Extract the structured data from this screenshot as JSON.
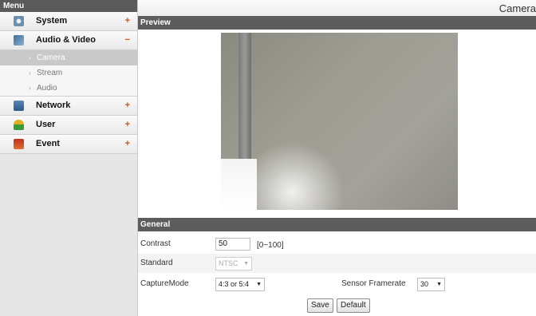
{
  "sidebar": {
    "header": "Menu",
    "items": [
      {
        "label": "System",
        "toggle": "+",
        "icon": "gear-icon"
      },
      {
        "label": "Audio & Video",
        "toggle": "−",
        "icon": "camera-icon",
        "subitems": [
          {
            "label": "Camera",
            "active": true
          },
          {
            "label": "Stream",
            "active": false
          },
          {
            "label": "Audio",
            "active": false
          }
        ]
      },
      {
        "label": "Network",
        "toggle": "+",
        "icon": "network-icon"
      },
      {
        "label": "User",
        "toggle": "+",
        "icon": "user-icon"
      },
      {
        "label": "Event",
        "toggle": "+",
        "icon": "event-icon"
      }
    ]
  },
  "main": {
    "title": "Camera",
    "preview_header": "Preview",
    "general_header": "General",
    "contrast": {
      "label": "Contrast",
      "value": "50",
      "hint": "[0~100]"
    },
    "standard": {
      "label": "Standard",
      "value": "NTSC",
      "disabled": true
    },
    "capture_mode": {
      "label": "CaptureMode",
      "value": "4:3 or 5:4"
    },
    "sensor_framerate": {
      "label": "Sensor Framerate",
      "value": "30"
    },
    "save_label": "Save",
    "default_label": "Default"
  },
  "colors": {
    "section_header_bg": "#5c5c5c",
    "active_subitem_bg": "#c9c9c9",
    "toggle_color": "#d05010"
  }
}
